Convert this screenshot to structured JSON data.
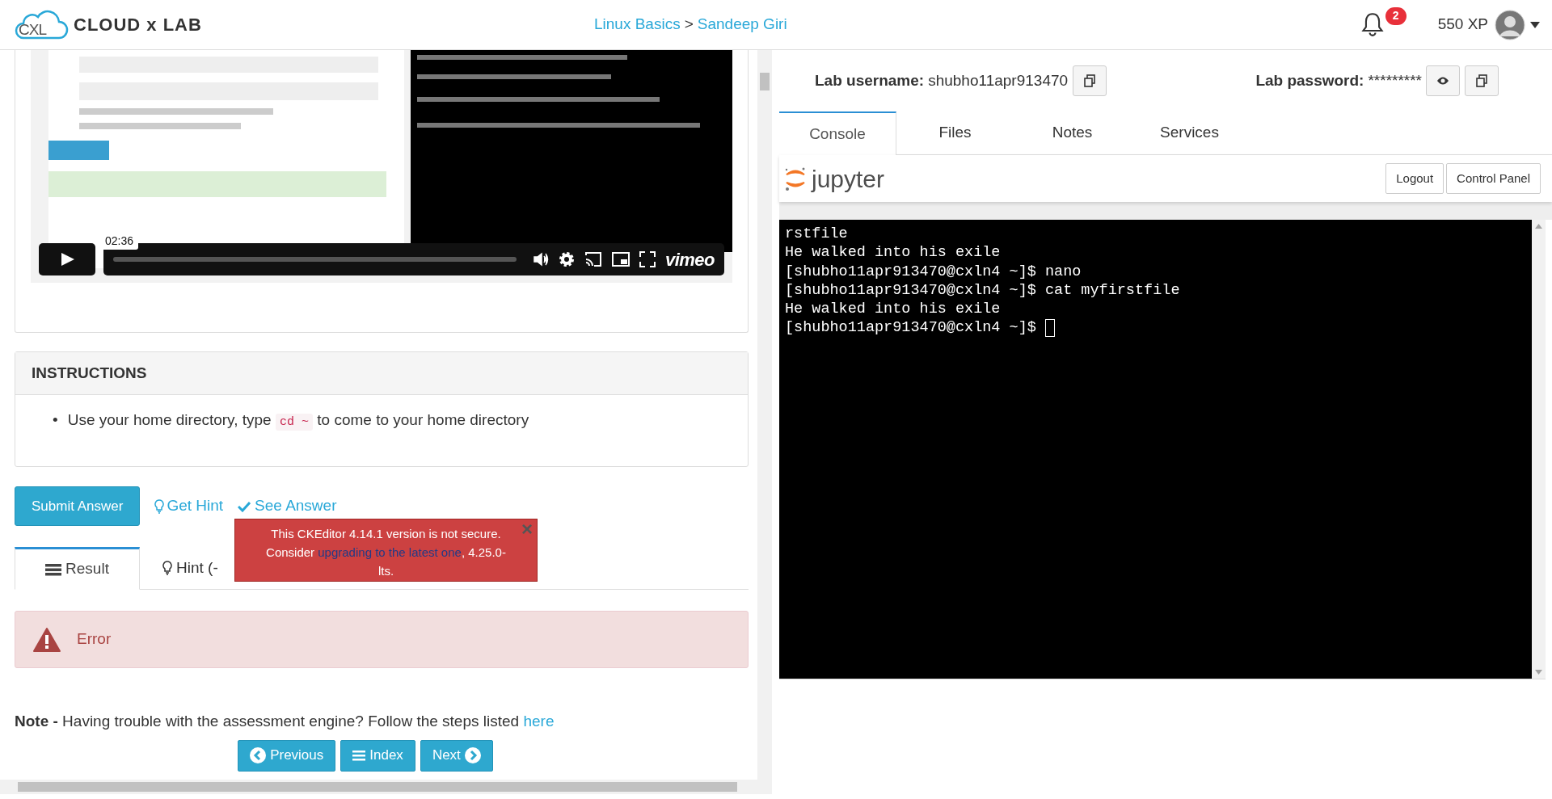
{
  "header": {
    "logo_mark": "CXL",
    "logo_text": "CLOUD x LAB",
    "breadcrumb": {
      "course": "Linux Basics",
      "separator": ">",
      "author": "Sandeep Giri"
    },
    "notification_count": "2",
    "xp": "550 XP"
  },
  "video": {
    "kind": "picture",
    "time_tooltip": "02:36",
    "brand": "vimeo"
  },
  "instructions": {
    "title": "INSTRUCTIONS",
    "items": [
      {
        "marker": "•",
        "before": "Use your home directory, type",
        "code": "cd ~",
        "after": "to come to your home directory"
      }
    ]
  },
  "actions": {
    "submit": "Submit Answer",
    "hint": "Get Hint",
    "answer": "See Answer"
  },
  "result_tabs": [
    {
      "label": "Result",
      "kind": "result",
      "selected": true
    },
    {
      "label": "Hint (-",
      "kind": "hint",
      "selected": false
    }
  ],
  "alert": {
    "text": "Error"
  },
  "note": {
    "label": "Note -",
    "text": "Having trouble with the assessment engine? Follow the steps listed",
    "link": "here"
  },
  "pager": [
    {
      "label": "Previous",
      "kind": "prev"
    },
    {
      "label": "Index",
      "kind": "index"
    },
    {
      "label": "Next",
      "kind": "next"
    }
  ],
  "toast": {
    "before": "This CKEditor 4.14.1 version is not secure. Consider",
    "link": "upgrading to the latest one",
    "after": ", 4.25.0-lts.",
    "close": "×"
  },
  "credentials": {
    "username_label": "Lab username:",
    "username": "shubho11apr913470",
    "password_label": "Lab password:",
    "password": "*********"
  },
  "lab_tabs": [
    {
      "label": "Console",
      "selected": true
    },
    {
      "label": "Files",
      "selected": false
    },
    {
      "label": "Notes",
      "selected": false
    },
    {
      "label": "Services",
      "selected": false
    }
  ],
  "jupyter": {
    "brand": "jupyter",
    "buttons": [
      "Logout",
      "Control Panel"
    ]
  },
  "terminal": {
    "lines": [
      "rstfile",
      "He walked into his exile",
      "[shubho11apr913470@cxln4 ~]$ nano",
      "[shubho11apr913470@cxln4 ~]$ cat myfirstfile",
      "He walked into his exile",
      "[shubho11apr913470@cxln4 ~]$ "
    ],
    "cursor": true
  }
}
